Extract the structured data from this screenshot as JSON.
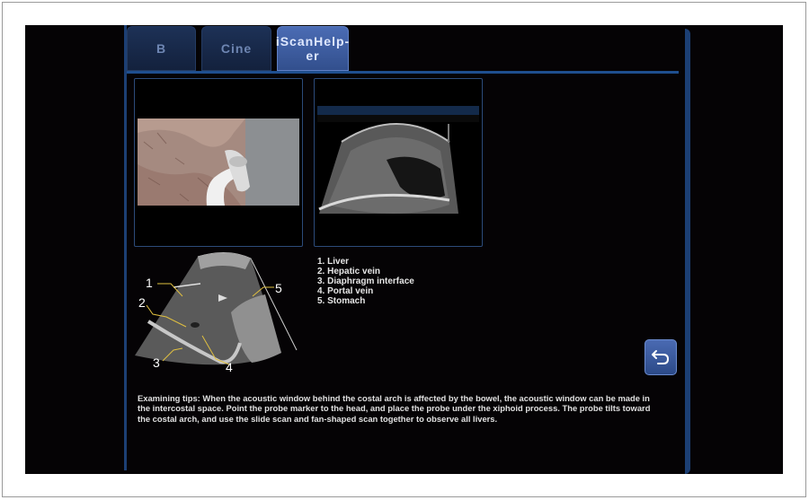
{
  "tabs": [
    {
      "label": "B",
      "active": false
    },
    {
      "label": "Cine",
      "active": false
    },
    {
      "label": "iScanHelp-er",
      "active": true
    }
  ],
  "tab_active_line1": "iScanHelp-",
  "tab_active_line2": "er",
  "legend": [
    "1. Liver",
    "2. Hepatic vein",
    "3. Diaphragm interface",
    "4. Portal vein",
    "5. Stomach"
  ],
  "diagram_numbers": [
    "1",
    "2",
    "3",
    "4",
    "5"
  ],
  "tips": "Examining tips: When the acoustic window behind the costal arch is affected by the bowel, the acoustic window can be made in the intercostal space. Point the probe marker to the head, and place the probe under the xiphoid process. The probe tilts toward the costal arch, and use the slide scan and fan-shaped scan together to observe all livers.",
  "back_icon": "return-arrow-icon",
  "colors": {
    "accent": "#1f4f8f",
    "tab_active": "#3e5ea0",
    "background": "#050305"
  }
}
